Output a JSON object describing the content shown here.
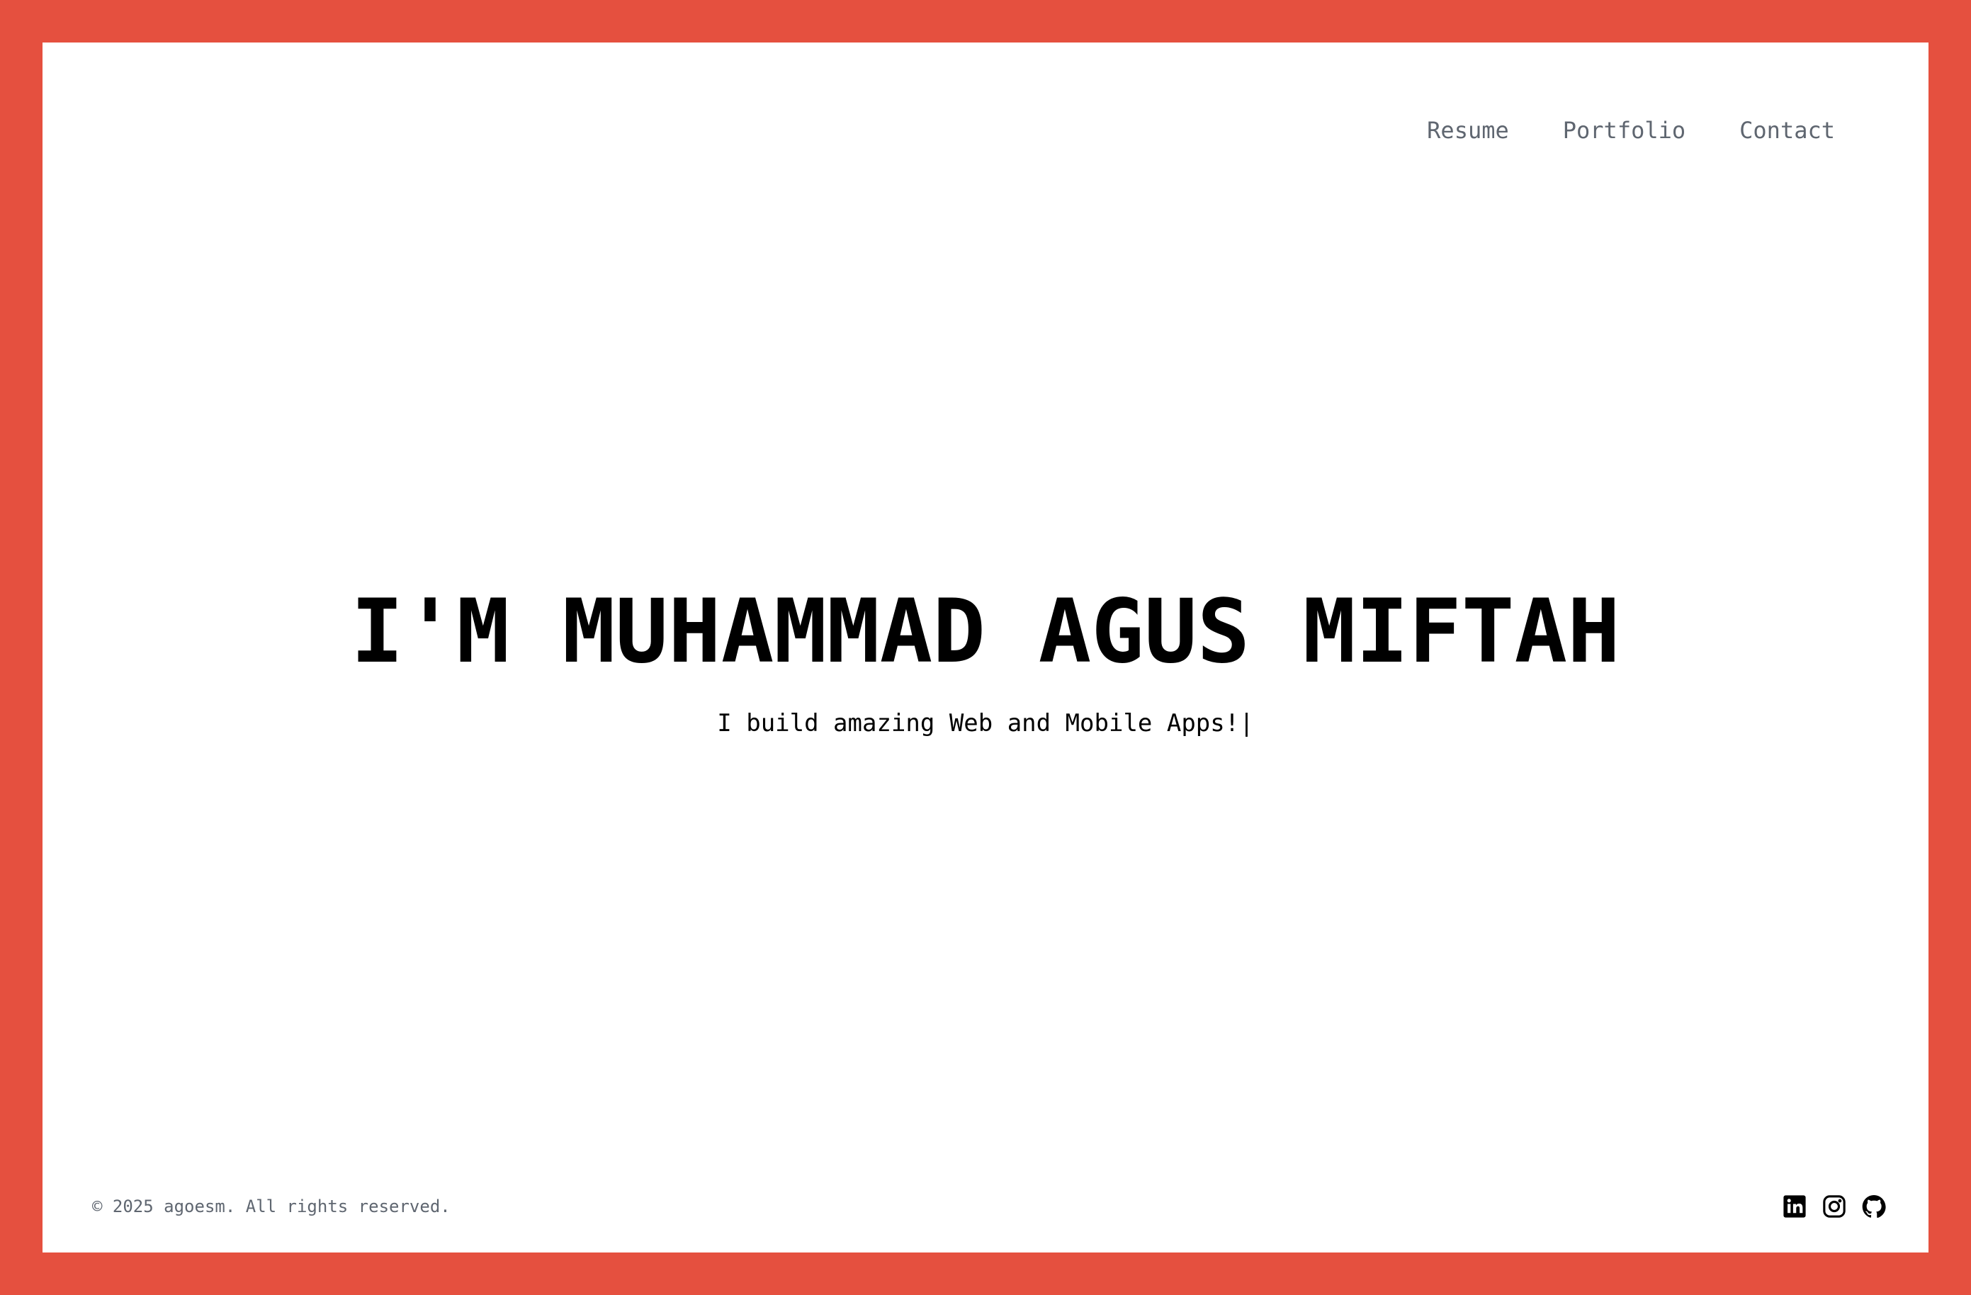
{
  "colors": {
    "frame_border": "#E5503F",
    "background": "#FFFFFF",
    "text_primary": "#000000",
    "text_muted": "#5F6670"
  },
  "nav": {
    "items": [
      {
        "label": "Resume"
      },
      {
        "label": "Portfolio"
      },
      {
        "label": "Contact"
      }
    ]
  },
  "hero": {
    "title": "I'M MUHAMMAD AGUS MIFTAH",
    "tagline": "I build amazing Web and Mobile Apps!",
    "cursor": "|"
  },
  "footer": {
    "copyright": "© 2025 agoesm. All rights reserved.",
    "social": [
      {
        "icon": "linkedin-icon"
      },
      {
        "icon": "instagram-icon"
      },
      {
        "icon": "github-icon"
      }
    ]
  }
}
